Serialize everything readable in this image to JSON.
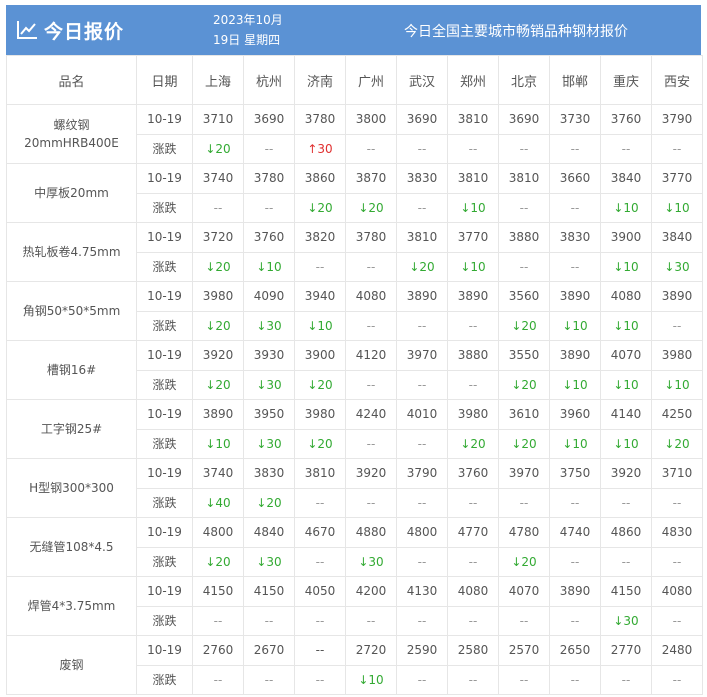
{
  "header": {
    "title": "今日报价",
    "date_line1": "2023年10月",
    "date_line2": "19日 星期四",
    "subtitle": "今日全国主要城市畅销品种钢材报价",
    "icon": "chart-line-icon",
    "bg_color": "#5b92d4"
  },
  "table": {
    "col_product": "品名",
    "col_date": "日期",
    "cities": [
      "上海",
      "杭州",
      "济南",
      "广州",
      "武汉",
      "郑州",
      "北京",
      "邯郸",
      "重庆",
      "西安"
    ],
    "products": [
      {
        "name": "螺纹钢20mmHRB400E",
        "date": "10-19",
        "change_label": "涨跌",
        "prices": [
          "3710",
          "3690",
          "3780",
          "3800",
          "3690",
          "3810",
          "3690",
          "3730",
          "3760",
          "3790"
        ],
        "changes": [
          "↓20",
          "--",
          "↑30",
          "--",
          "--",
          "--",
          "--",
          "--",
          "--",
          "--"
        ]
      },
      {
        "name": "中厚板20mm",
        "date": "10-19",
        "change_label": "涨跌",
        "prices": [
          "3740",
          "3780",
          "3860",
          "3870",
          "3830",
          "3810",
          "3810",
          "3660",
          "3840",
          "3770"
        ],
        "changes": [
          "--",
          "--",
          "↓20",
          "↓20",
          "--",
          "↓10",
          "--",
          "--",
          "↓10",
          "↓10"
        ]
      },
      {
        "name": "热轧板卷4.75mm",
        "date": "10-19",
        "change_label": "涨跌",
        "prices": [
          "3720",
          "3760",
          "3820",
          "3780",
          "3810",
          "3770",
          "3880",
          "3830",
          "3900",
          "3840"
        ],
        "changes": [
          "↓20",
          "↓10",
          "--",
          "--",
          "↓20",
          "↓10",
          "--",
          "--",
          "↓10",
          "↓30"
        ]
      },
      {
        "name": "角钢50*50*5mm",
        "date": "10-19",
        "change_label": "涨跌",
        "prices": [
          "3980",
          "4090",
          "3940",
          "4080",
          "3890",
          "3890",
          "3560",
          "3890",
          "4080",
          "3890"
        ],
        "changes": [
          "↓20",
          "↓30",
          "↓10",
          "--",
          "--",
          "--",
          "↓20",
          "↓10",
          "↓10",
          "--"
        ]
      },
      {
        "name": "槽钢16#",
        "date": "10-19",
        "change_label": "涨跌",
        "prices": [
          "3920",
          "3930",
          "3900",
          "4120",
          "3970",
          "3880",
          "3550",
          "3890",
          "4070",
          "3980"
        ],
        "changes": [
          "↓20",
          "↓30",
          "↓20",
          "--",
          "--",
          "--",
          "↓20",
          "↓10",
          "↓10",
          "↓10"
        ]
      },
      {
        "name": "工字钢25#",
        "date": "10-19",
        "change_label": "涨跌",
        "prices": [
          "3890",
          "3950",
          "3980",
          "4240",
          "4010",
          "3980",
          "3610",
          "3960",
          "4140",
          "4250"
        ],
        "changes": [
          "↓10",
          "↓30",
          "↓20",
          "--",
          "--",
          "↓20",
          "↓20",
          "↓10",
          "↓10",
          "↓20"
        ]
      },
      {
        "name": "H型钢300*300",
        "date": "10-19",
        "change_label": "涨跌",
        "prices": [
          "3740",
          "3830",
          "3810",
          "3920",
          "3790",
          "3760",
          "3970",
          "3750",
          "3920",
          "3710"
        ],
        "changes": [
          "↓40",
          "↓20",
          "--",
          "--",
          "--",
          "--",
          "--",
          "--",
          "--",
          "--"
        ]
      },
      {
        "name": "无缝管108*4.5",
        "date": "10-19",
        "change_label": "涨跌",
        "prices": [
          "4800",
          "4840",
          "4670",
          "4880",
          "4800",
          "4770",
          "4780",
          "4740",
          "4860",
          "4830"
        ],
        "changes": [
          "↓20",
          "↓30",
          "--",
          "↓30",
          "--",
          "--",
          "↓20",
          "--",
          "--",
          "--"
        ]
      },
      {
        "name": "焊管4*3.75mm",
        "date": "10-19",
        "change_label": "涨跌",
        "prices": [
          "4150",
          "4150",
          "4050",
          "4200",
          "4130",
          "4080",
          "4070",
          "3890",
          "4150",
          "4080"
        ],
        "changes": [
          "--",
          "--",
          "--",
          "--",
          "--",
          "--",
          "--",
          "--",
          "↓30",
          "--"
        ]
      },
      {
        "name": "废钢",
        "date": "10-19",
        "change_label": "涨跌",
        "prices": [
          "2760",
          "2670",
          "--",
          "2720",
          "2590",
          "2580",
          "2570",
          "2650",
          "2770",
          "2480"
        ],
        "changes": [
          "--",
          "--",
          "--",
          "↓10",
          "--",
          "--",
          "--",
          "--",
          "--",
          "--"
        ]
      }
    ]
  },
  "colors": {
    "down": "#33aa33",
    "up": "#e03030",
    "grid": "#e6e6e6"
  }
}
